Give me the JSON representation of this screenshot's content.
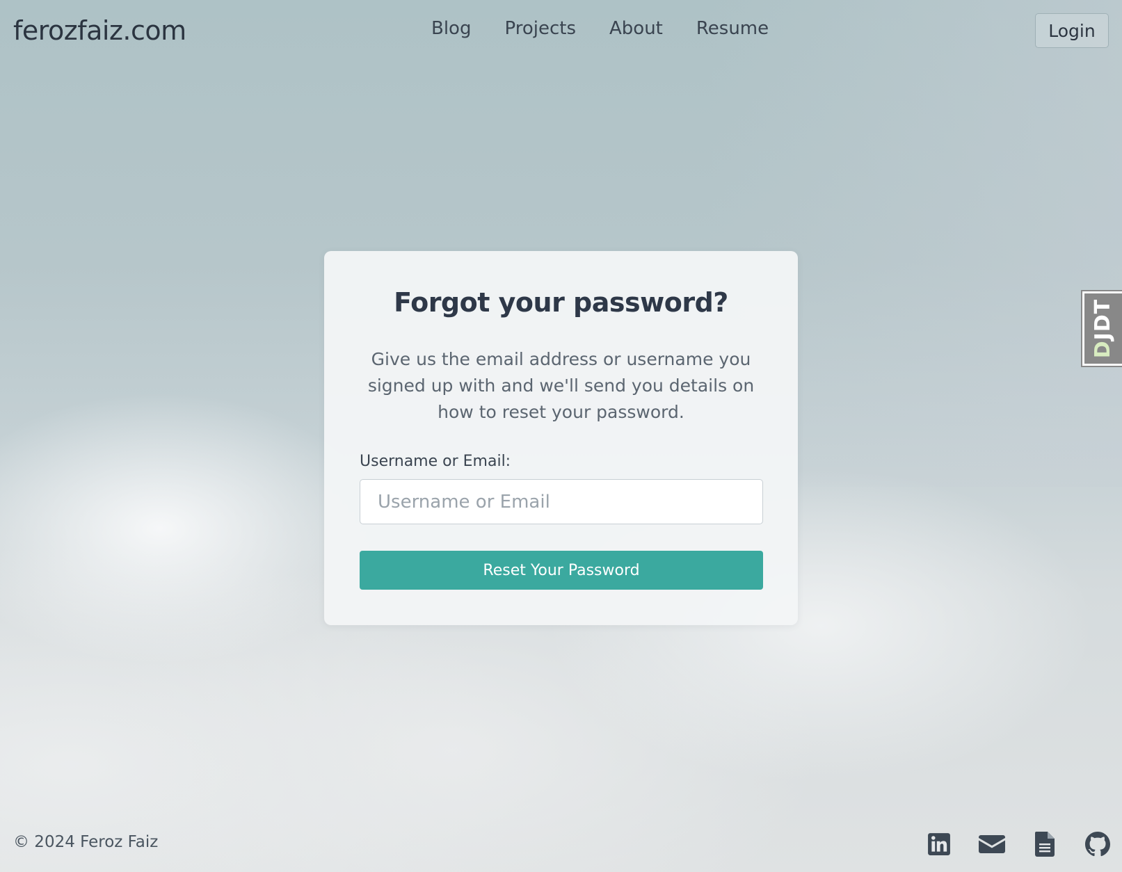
{
  "header": {
    "brand": "ferozfaiz.com",
    "nav": [
      {
        "label": "Blog"
      },
      {
        "label": "Projects"
      },
      {
        "label": "About"
      },
      {
        "label": "Resume"
      }
    ],
    "login_label": "Login"
  },
  "card": {
    "title": "Forgot your password?",
    "description": "Give us the email address or username you signed up with and we'll send you details on how to reset your password.",
    "field_label": "Username or Email:",
    "field_placeholder": "Username or Email",
    "field_value": "",
    "submit_label": "Reset Your Password"
  },
  "djdt": {
    "label_d": "D",
    "label_rest": "JDT"
  },
  "footer": {
    "copyright": "© 2024 Feroz Faiz",
    "social_icons": [
      "linkedin-icon",
      "email-icon",
      "resume-document-icon",
      "github-icon"
    ]
  },
  "colors": {
    "accent": "#3ba99f",
    "text_dark": "#2e3848",
    "icon_dark": "#3d4854"
  }
}
